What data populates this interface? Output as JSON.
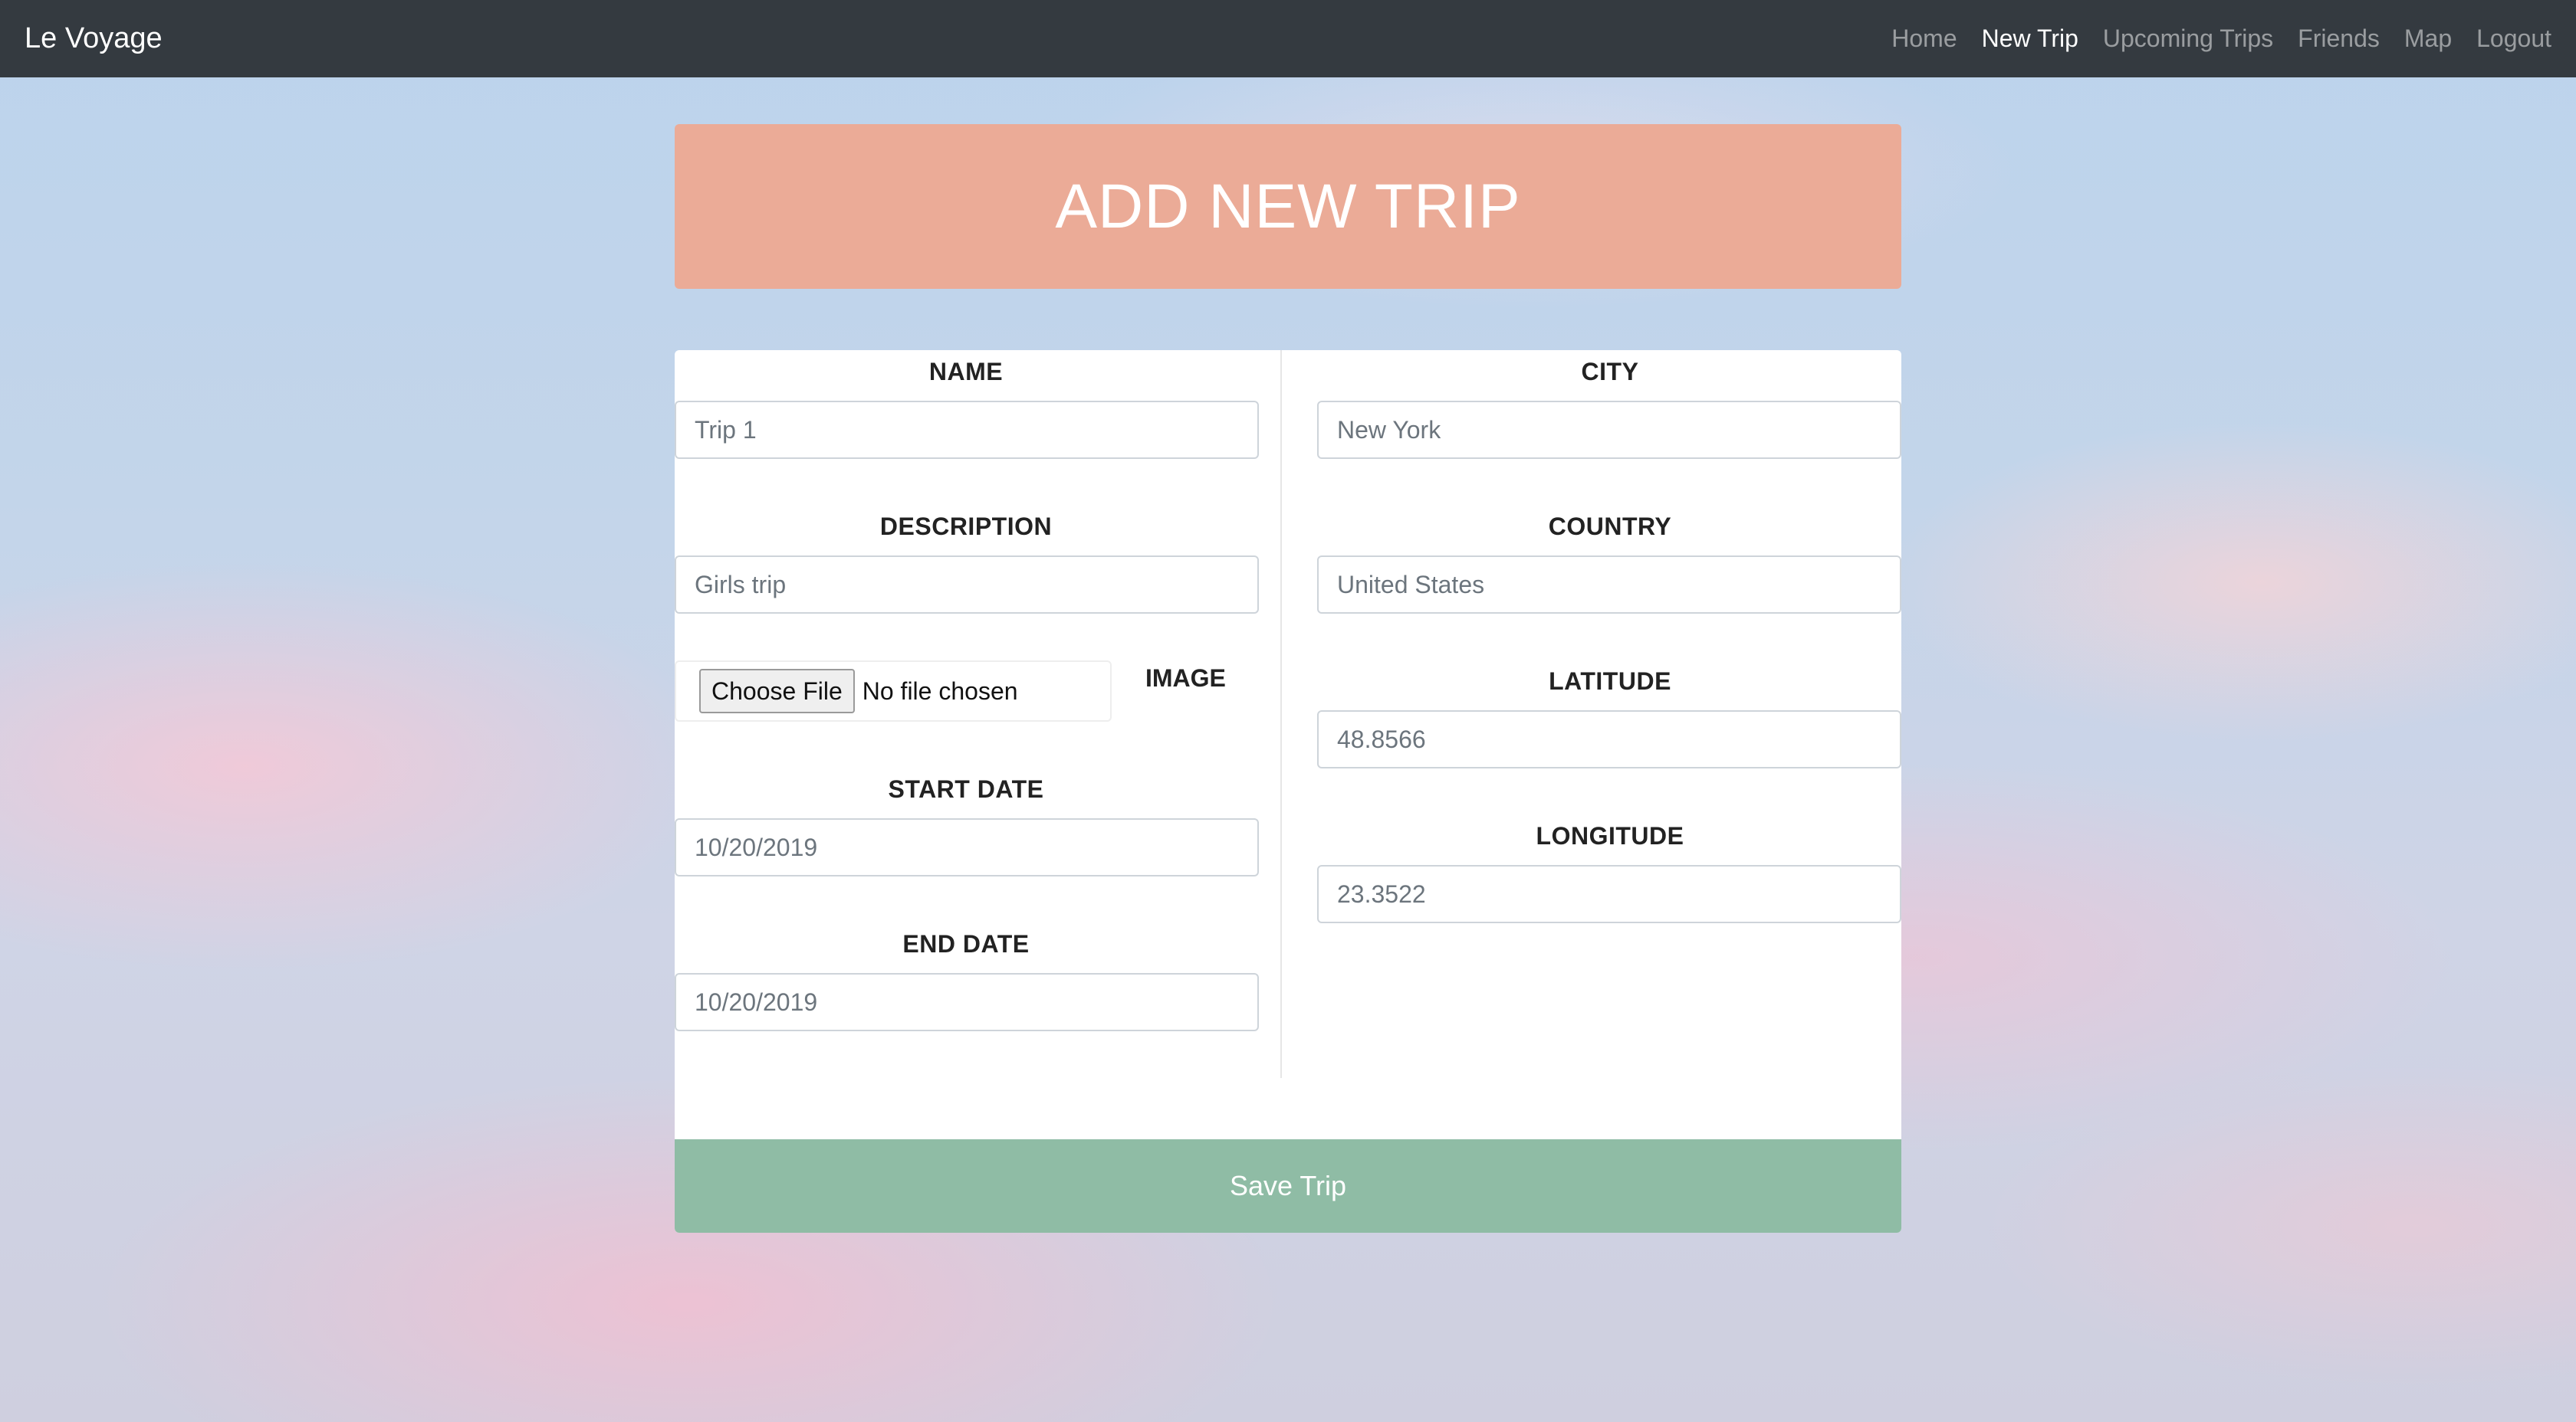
{
  "navbar": {
    "brand": "Le Voyage",
    "links": [
      {
        "label": "Home",
        "active": false
      },
      {
        "label": "New Trip",
        "active": true
      },
      {
        "label": "Upcoming Trips",
        "active": false
      },
      {
        "label": "Friends",
        "active": false
      },
      {
        "label": "Map",
        "active": false
      },
      {
        "label": "Logout",
        "active": false
      }
    ]
  },
  "banner": {
    "title": "ADD NEW TRIP",
    "color": "#ebab97"
  },
  "form": {
    "name": {
      "label": "NAME",
      "placeholder": "Trip 1"
    },
    "description": {
      "label": "DESCRIPTION",
      "placeholder": "Girls trip"
    },
    "image": {
      "label": "IMAGE",
      "button": "Choose File",
      "status": "No file chosen"
    },
    "start_date": {
      "label": "START DATE",
      "placeholder": "10/20/2019"
    },
    "end_date": {
      "label": "END DATE",
      "placeholder": "10/20/2019"
    },
    "city": {
      "label": "CITY",
      "placeholder": "New York"
    },
    "country": {
      "label": "COUNTRY",
      "placeholder": "United States"
    },
    "latitude": {
      "label": "LATITUDE",
      "placeholder": "48.8566"
    },
    "longitude": {
      "label": "LONGITUDE",
      "placeholder": "23.3522"
    },
    "save_label": "Save Trip",
    "save_color": "#8fbca5"
  }
}
